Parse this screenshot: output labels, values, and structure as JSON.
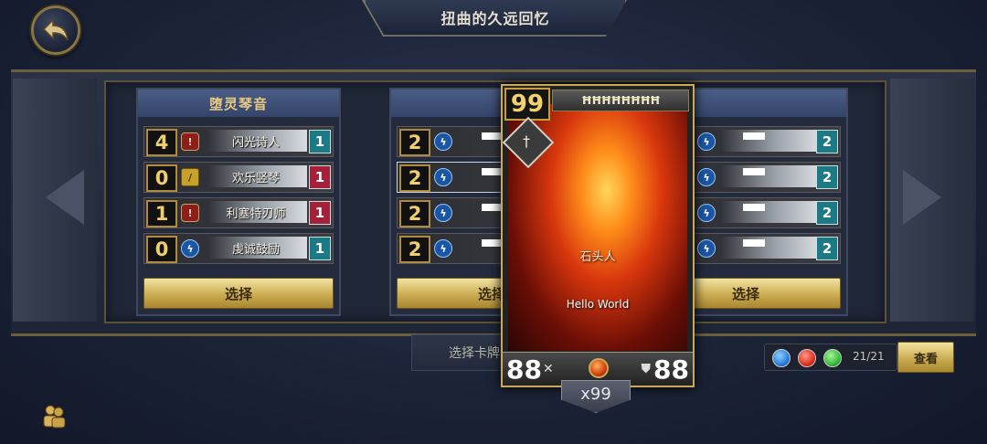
{
  "header": {
    "title": "扭曲的久远回忆",
    "back_label": "back"
  },
  "decks": [
    {
      "title": "堕灵琴音",
      "cards": [
        {
          "cost": "4",
          "class": "red",
          "name": "闪光诗人",
          "count": "1",
          "count_color": "teal"
        },
        {
          "cost": "0",
          "class": "yellow",
          "name": "欢乐竖琴",
          "count": "1",
          "count_color": "red"
        },
        {
          "cost": "1",
          "class": "red",
          "name": "利塞特刃师",
          "count": "1",
          "count_color": "red"
        },
        {
          "cost": "0",
          "class": "blue",
          "name": "虔诚鼓励",
          "count": "1",
          "count_color": "teal"
        }
      ],
      "select_label": "选择"
    },
    {
      "title": "",
      "cards": [
        {
          "cost": "2",
          "class": "blue",
          "name": "",
          "count": "",
          "count_color": "teal"
        },
        {
          "cost": "2",
          "class": "blue",
          "name": "",
          "count": "",
          "count_color": "teal"
        },
        {
          "cost": "2",
          "class": "blue",
          "name": "",
          "count": "",
          "count_color": "teal"
        },
        {
          "cost": "2",
          "class": "blue",
          "name": "",
          "count": "",
          "count_color": "teal"
        }
      ],
      "select_label": "选择"
    },
    {
      "title": "",
      "cards": [
        {
          "cost": "",
          "class": "blue",
          "name": "",
          "count": "2",
          "count_color": "teal"
        },
        {
          "cost": "",
          "class": "blue",
          "name": "",
          "count": "2",
          "count_color": "teal"
        },
        {
          "cost": "",
          "class": "blue",
          "name": "",
          "count": "2",
          "count_color": "teal"
        },
        {
          "cost": "",
          "class": "blue",
          "name": "",
          "count": "2",
          "count_color": "teal"
        }
      ],
      "select_label": "选择"
    }
  ],
  "hint": "选择卡牌",
  "big_card": {
    "cost": "99",
    "title": "ĦĦĦĦĦĦĦĦ",
    "race": "石头人",
    "description": "Hello World",
    "attack": "88",
    "health": "88",
    "quantity": "x99"
  },
  "gems": {
    "colors": [
      "#2a7fe0",
      "#e0321f",
      "#35c03a"
    ],
    "count": "21/21"
  },
  "view_label": "查看"
}
